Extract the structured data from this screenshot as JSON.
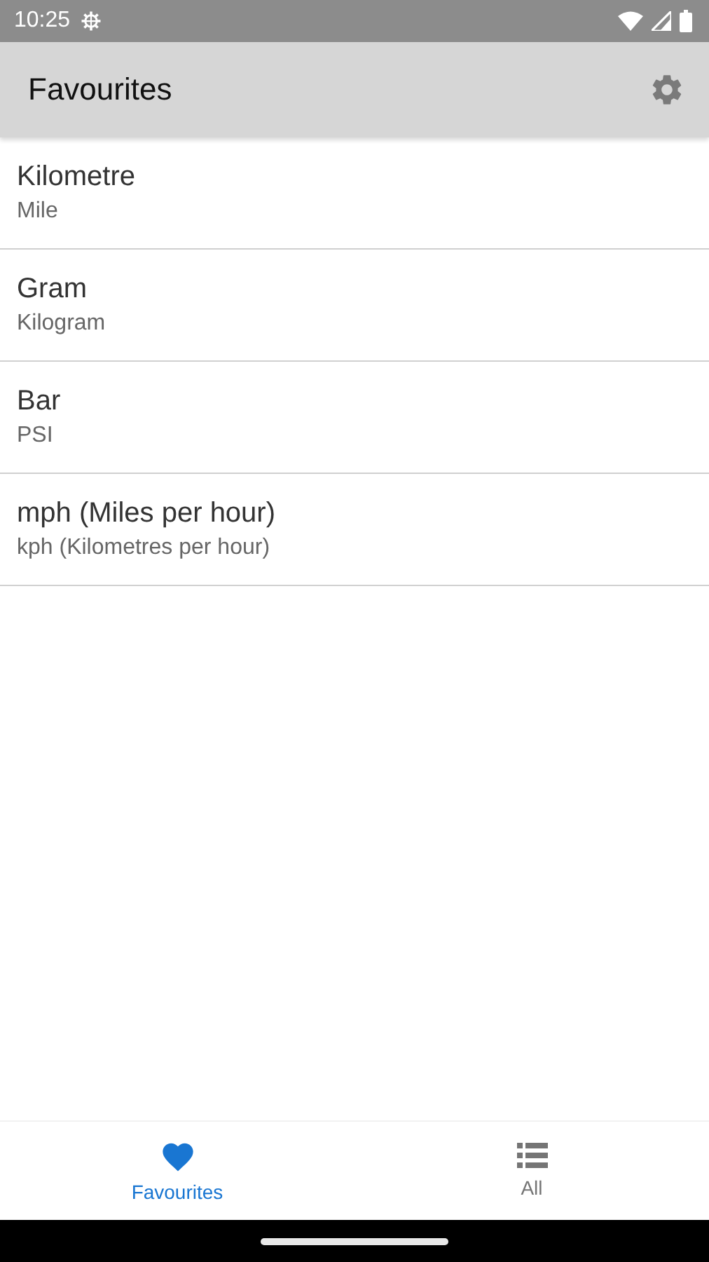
{
  "status_bar": {
    "time": "10:25"
  },
  "app_bar": {
    "title": "Favourites"
  },
  "favourites": [
    {
      "from": "Kilometre",
      "to": "Mile"
    },
    {
      "from": "Gram",
      "to": "Kilogram"
    },
    {
      "from": "Bar",
      "to": "PSI"
    },
    {
      "from": "mph (Miles per hour)",
      "to": "kph (Kilometres per hour)"
    }
  ],
  "bottom_nav": [
    {
      "label": "Favourites",
      "kind": "heart",
      "selected": true
    },
    {
      "label": "All",
      "kind": "list",
      "selected": false
    }
  ]
}
